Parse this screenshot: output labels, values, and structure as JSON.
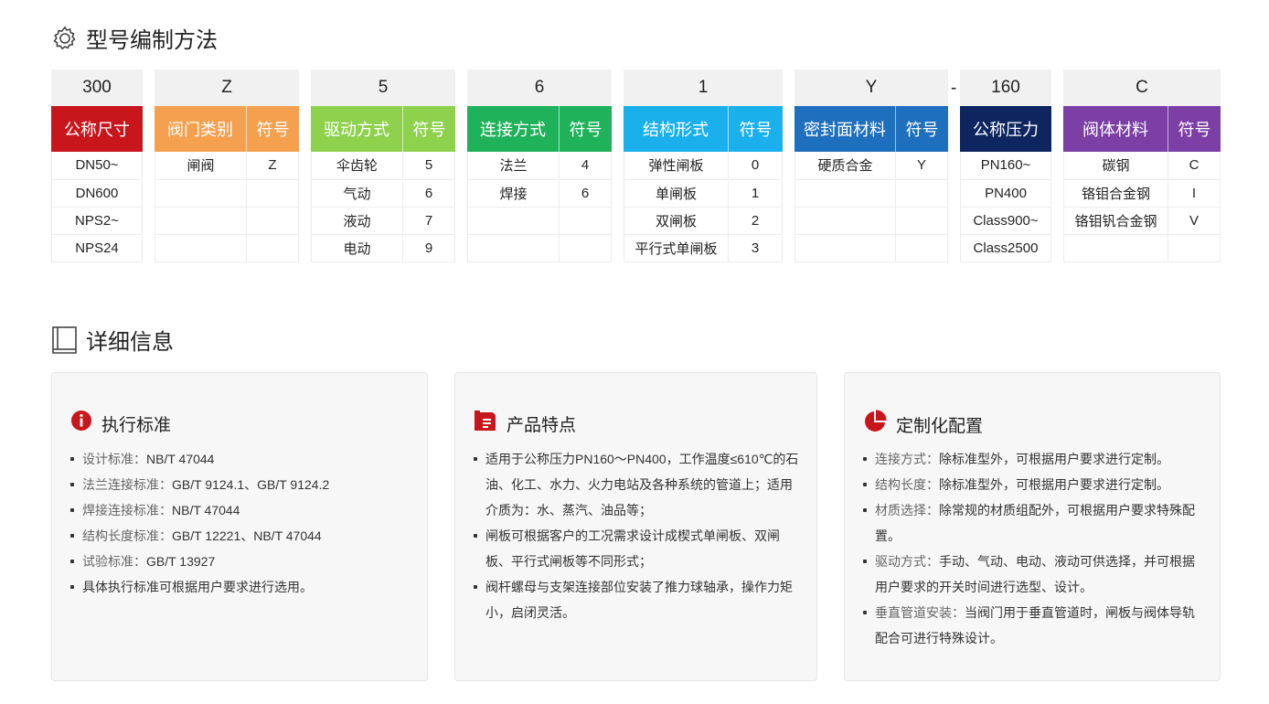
{
  "sections": {
    "model": {
      "title": "型号编制方法",
      "icon": "gear-icon"
    },
    "detail": {
      "title": "详细信息",
      "icon": "book-icon"
    }
  },
  "code_table": {
    "columns": [
      {
        "code": "300",
        "color": "#c8161d",
        "headers": [
          "公称尺寸"
        ],
        "rows": [
          [
            "DN50~"
          ],
          [
            "DN600"
          ],
          [
            "NPS2~"
          ],
          [
            "NPS24"
          ]
        ]
      },
      {
        "code": "Z",
        "color": "#f5a04e",
        "headers": [
          "阀门类别",
          "符号"
        ],
        "rows": [
          [
            "闸阀",
            "Z"
          ],
          [
            "",
            ""
          ],
          [
            "",
            ""
          ],
          [
            "",
            ""
          ]
        ]
      },
      {
        "code": "5",
        "color": "#8dd14d",
        "headers": [
          "驱动方式",
          "符号"
        ],
        "rows": [
          [
            "伞齿轮",
            "5"
          ],
          [
            "气动",
            "6"
          ],
          [
            "液动",
            "7"
          ],
          [
            "电动",
            "9"
          ]
        ]
      },
      {
        "code": "6",
        "color": "#1fb25a",
        "headers": [
          "连接方式",
          "符号"
        ],
        "rows": [
          [
            "法兰",
            "4"
          ],
          [
            "焊接",
            "6"
          ],
          [
            "",
            ""
          ],
          [
            "",
            ""
          ]
        ]
      },
      {
        "code": "1",
        "color": "#1ab0ec",
        "headers": [
          "结构形式",
          "符号"
        ],
        "rows": [
          [
            "弹性闸板",
            "0"
          ],
          [
            "单闸板",
            "1"
          ],
          [
            "双闸板",
            "2"
          ],
          [
            "平行式单闸板",
            "3"
          ]
        ]
      },
      {
        "code": "Y",
        "color": "#1e6fbd",
        "headers": [
          "密封面材料",
          "符号"
        ],
        "rows": [
          [
            "硬质合金",
            "Y"
          ],
          [
            "",
            ""
          ],
          [
            "",
            ""
          ],
          [
            "",
            ""
          ]
        ]
      },
      {
        "code": "160",
        "color": "#0e2560",
        "headers": [
          "公称压力"
        ],
        "rows": [
          [
            "PN160~"
          ],
          [
            "PN400"
          ],
          [
            "Class900~"
          ],
          [
            "Class2500"
          ]
        ]
      },
      {
        "code": "C",
        "color": "#7b3fa6",
        "headers": [
          "阀体材料",
          "符号"
        ],
        "rows": [
          [
            "碳钢",
            "C"
          ],
          [
            "铬钼合金钢",
            "I"
          ],
          [
            "铬钼钒合金钢",
            "V"
          ],
          [
            "",
            ""
          ]
        ]
      }
    ],
    "separator": "-"
  },
  "cards": [
    {
      "title": "执行标准",
      "icon": "info-icon",
      "accent": "#c8161d",
      "items": [
        {
          "label": "设计标准：",
          "value": "NB/T 47044"
        },
        {
          "label": "法兰连接标准：",
          "value": "GB/T 9124.1、GB/T 9124.2"
        },
        {
          "label": "焊接连接标准：",
          "value": "NB/T 47044"
        },
        {
          "label": "结构长度标准：",
          "value": "GB/T 12221、NB/T 47044"
        },
        {
          "label": "试验标准：",
          "value": "GB/T 13927"
        },
        {
          "label": "",
          "value": "具体执行标准可根据用户要求进行选用。"
        }
      ]
    },
    {
      "title": "产品特点",
      "icon": "document-icon",
      "accent": "#c8161d",
      "items": [
        {
          "label": "",
          "value": "适用于公称压力PN160～PN400，工作温度≤610℃的石油、化工、水力、火力电站及各种系统的管道上；适用介质为：水、蒸汽、油品等；"
        },
        {
          "label": "",
          "value": "闸板可根据客户的工况需求设计成楔式单闸板、双闸板、平行式闸板等不同形式；"
        },
        {
          "label": "",
          "value": "阀杆螺母与支架连接部位安装了推力球轴承，操作力矩小，启闭灵活。"
        }
      ]
    },
    {
      "title": "定制化配置",
      "icon": "pie-chart-icon",
      "accent": "#c8161d",
      "items": [
        {
          "label": "连接方式：",
          "value": "除标准型外，可根据用户要求进行定制。"
        },
        {
          "label": "结构长度：",
          "value": "除标准型外，可根据用户要求进行定制。"
        },
        {
          "label": "材质选择：",
          "value": "除常规的材质组配外，可根据用户要求特殊配置。"
        },
        {
          "label": "驱动方式：",
          "value": "手动、气动、电动、液动可供选择，并可根据用户要求的开关时间进行选型、设计。"
        },
        {
          "label": "垂直管道安装：",
          "value": "当阀门用于垂直管道时，闸板与阀体导轨配合可进行特殊设计。"
        }
      ]
    }
  ]
}
